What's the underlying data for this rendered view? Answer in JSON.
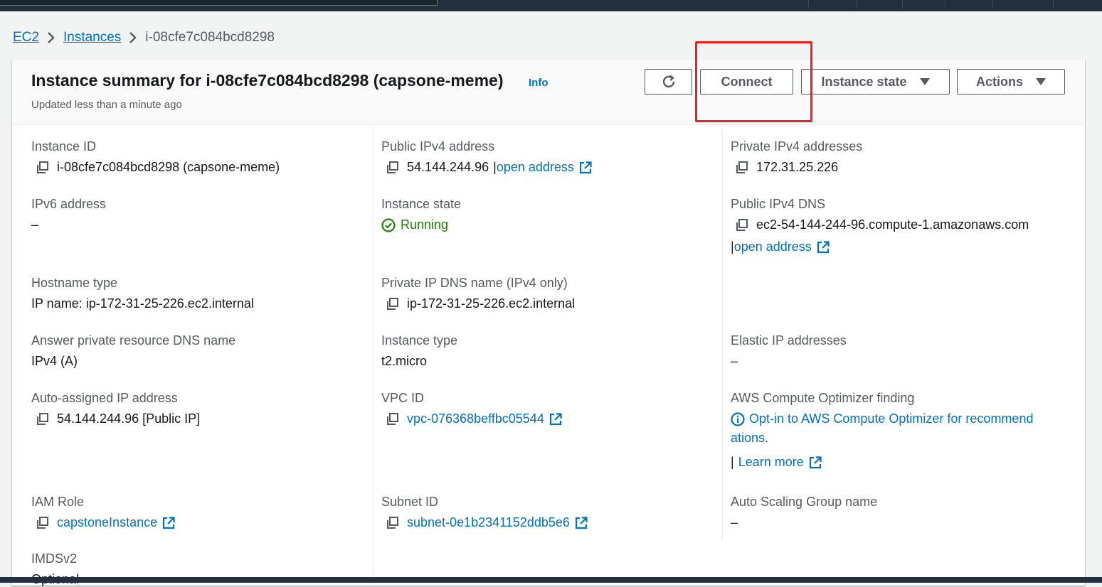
{
  "breadcrumb": {
    "root": "EC2",
    "instances": "Instances",
    "current": "i-08cfe7c084bcd8298"
  },
  "header": {
    "title": "Instance summary for i-08cfe7c084bcd8298 (capsone-meme)",
    "info": "Info",
    "subtitle": "Updated less than a minute ago"
  },
  "toolbar": {
    "refresh_icon": "refresh-icon",
    "connect_label": "Connect",
    "instance_state_label": "Instance state",
    "actions_label": "Actions"
  },
  "details": {
    "col1": {
      "instance_id": {
        "label": "Instance ID",
        "value": "i-08cfe7c084bcd8298 (capsone-meme)"
      },
      "ipv6": {
        "label": "IPv6 address",
        "value": "–"
      },
      "hostname_type": {
        "label": "Hostname type",
        "value": "IP name: ip-172-31-25-226.ec2.internal"
      },
      "answer_dns": {
        "label": "Answer private resource DNS name",
        "value": "IPv4 (A)"
      },
      "auto_ip": {
        "label": "Auto-assigned IP address",
        "value": "54.144.244.96 [Public IP]"
      },
      "iam_role": {
        "label": "IAM Role",
        "value": "capstoneInstance"
      },
      "imdsv2": {
        "label": "IMDSv2",
        "value": "Optional"
      }
    },
    "col2": {
      "public_ipv4": {
        "label": "Public IPv4 address",
        "value": "54.144.244.96",
        "sep": "|",
        "link": "open address"
      },
      "instance_state": {
        "label": "Instance state",
        "value": "Running"
      },
      "private_dns": {
        "label": "Private IP DNS name (IPv4 only)",
        "value": "ip-172-31-25-226.ec2.internal"
      },
      "instance_type": {
        "label": "Instance type",
        "value": "t2.micro"
      },
      "vpc_id": {
        "label": "VPC ID",
        "value": "vpc-076368beffbc05544"
      },
      "subnet_id": {
        "label": "Subnet ID",
        "value": "subnet-0e1b2341152ddb5e6"
      }
    },
    "col3": {
      "private_ipv4": {
        "label": "Private IPv4 addresses",
        "value": "172.31.25.226"
      },
      "public_dns": {
        "label": "Public IPv4 DNS",
        "value": "ec2-54-144-244-96.compute-1.amazonaws.com",
        "sep": "|",
        "link": "open address"
      },
      "elastic_ip": {
        "label": "Elastic IP addresses",
        "value": "–"
      },
      "optimizer": {
        "label": "AWS Compute Optimizer finding",
        "line1": "Opt-in to AWS Compute Optimizer for recommend",
        "line2": "ations.",
        "sep": "|",
        "learn_more": "Learn more"
      },
      "asg_name": {
        "label": "Auto Scaling Group name",
        "value": "–"
      }
    }
  },
  "colors": {
    "link": "#0073bb",
    "success": "#1d8102",
    "highlight": "#ff1a1a",
    "topbar": "#232f3e"
  }
}
